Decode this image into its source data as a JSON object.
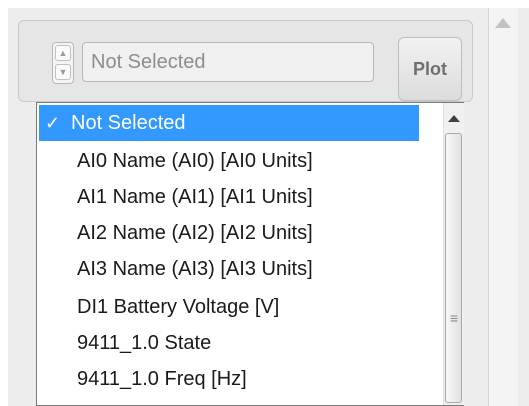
{
  "combo": {
    "value": "Not Selected"
  },
  "plot_button": {
    "label": "Plot"
  },
  "dropdown": {
    "check_glyph": "✓",
    "items": [
      {
        "label": "Not Selected",
        "selected": true
      },
      {
        "label": "AI0 Name (AI0) [AI0 Units]",
        "selected": false
      },
      {
        "label": "AI1 Name (AI1) [AI1 Units]",
        "selected": false
      },
      {
        "label": "AI2 Name (AI2) [AI2 Units]",
        "selected": false
      },
      {
        "label": "AI3 Name (AI3) [AI3 Units]",
        "selected": false
      },
      {
        "label": "DI1 Battery Voltage [V]",
        "selected": false
      },
      {
        "label": "9411_1.0 State",
        "selected": false
      },
      {
        "label": "9411_1.0 Freq [Hz]",
        "selected": false
      }
    ]
  },
  "colors": {
    "selection": "#3399ff",
    "panel": "#ededed"
  }
}
